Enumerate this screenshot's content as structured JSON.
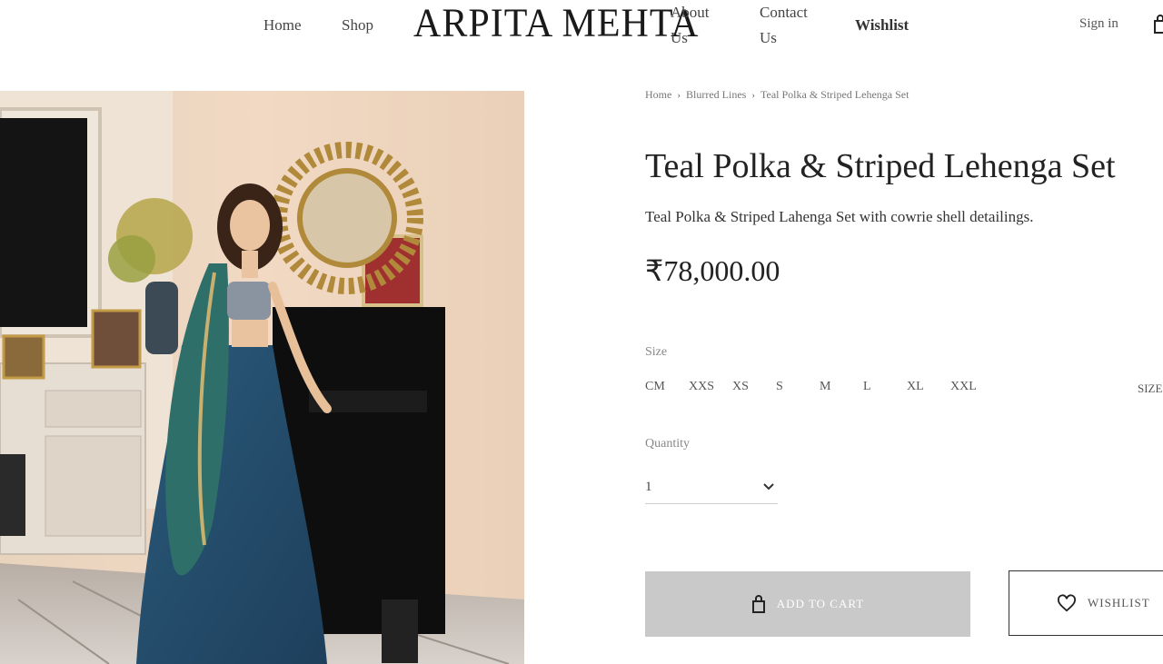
{
  "header": {
    "nav_left": [
      "Home",
      "Shop"
    ],
    "logo": "ARPITA MEHTA",
    "about": "About Us",
    "contact": "Contact Us",
    "wishlist": "Wishlist",
    "signin": "Sign in"
  },
  "breadcrumb": [
    "Home",
    "Blurred Lines",
    "Teal Polka & Striped Lehenga Set"
  ],
  "product": {
    "title": "Teal Polka & Striped Lehenga Set",
    "description": "Teal Polka & Striped Lahenga Set with cowrie shell detailings.",
    "price": "₹78,000.00"
  },
  "size": {
    "label": "Size",
    "options": [
      "CM",
      "XXS",
      "XS",
      "S",
      "M",
      "L",
      "XL",
      "XXL"
    ],
    "chart_link": "SIZE"
  },
  "quantity": {
    "label": "Quantity",
    "value": "1"
  },
  "buttons": {
    "add_to_cart": "ADD TO CART",
    "wishlist": "WISHLIST"
  },
  "colors": {
    "add_to_cart_bg": "#c9c9c9",
    "border": "#333333"
  }
}
